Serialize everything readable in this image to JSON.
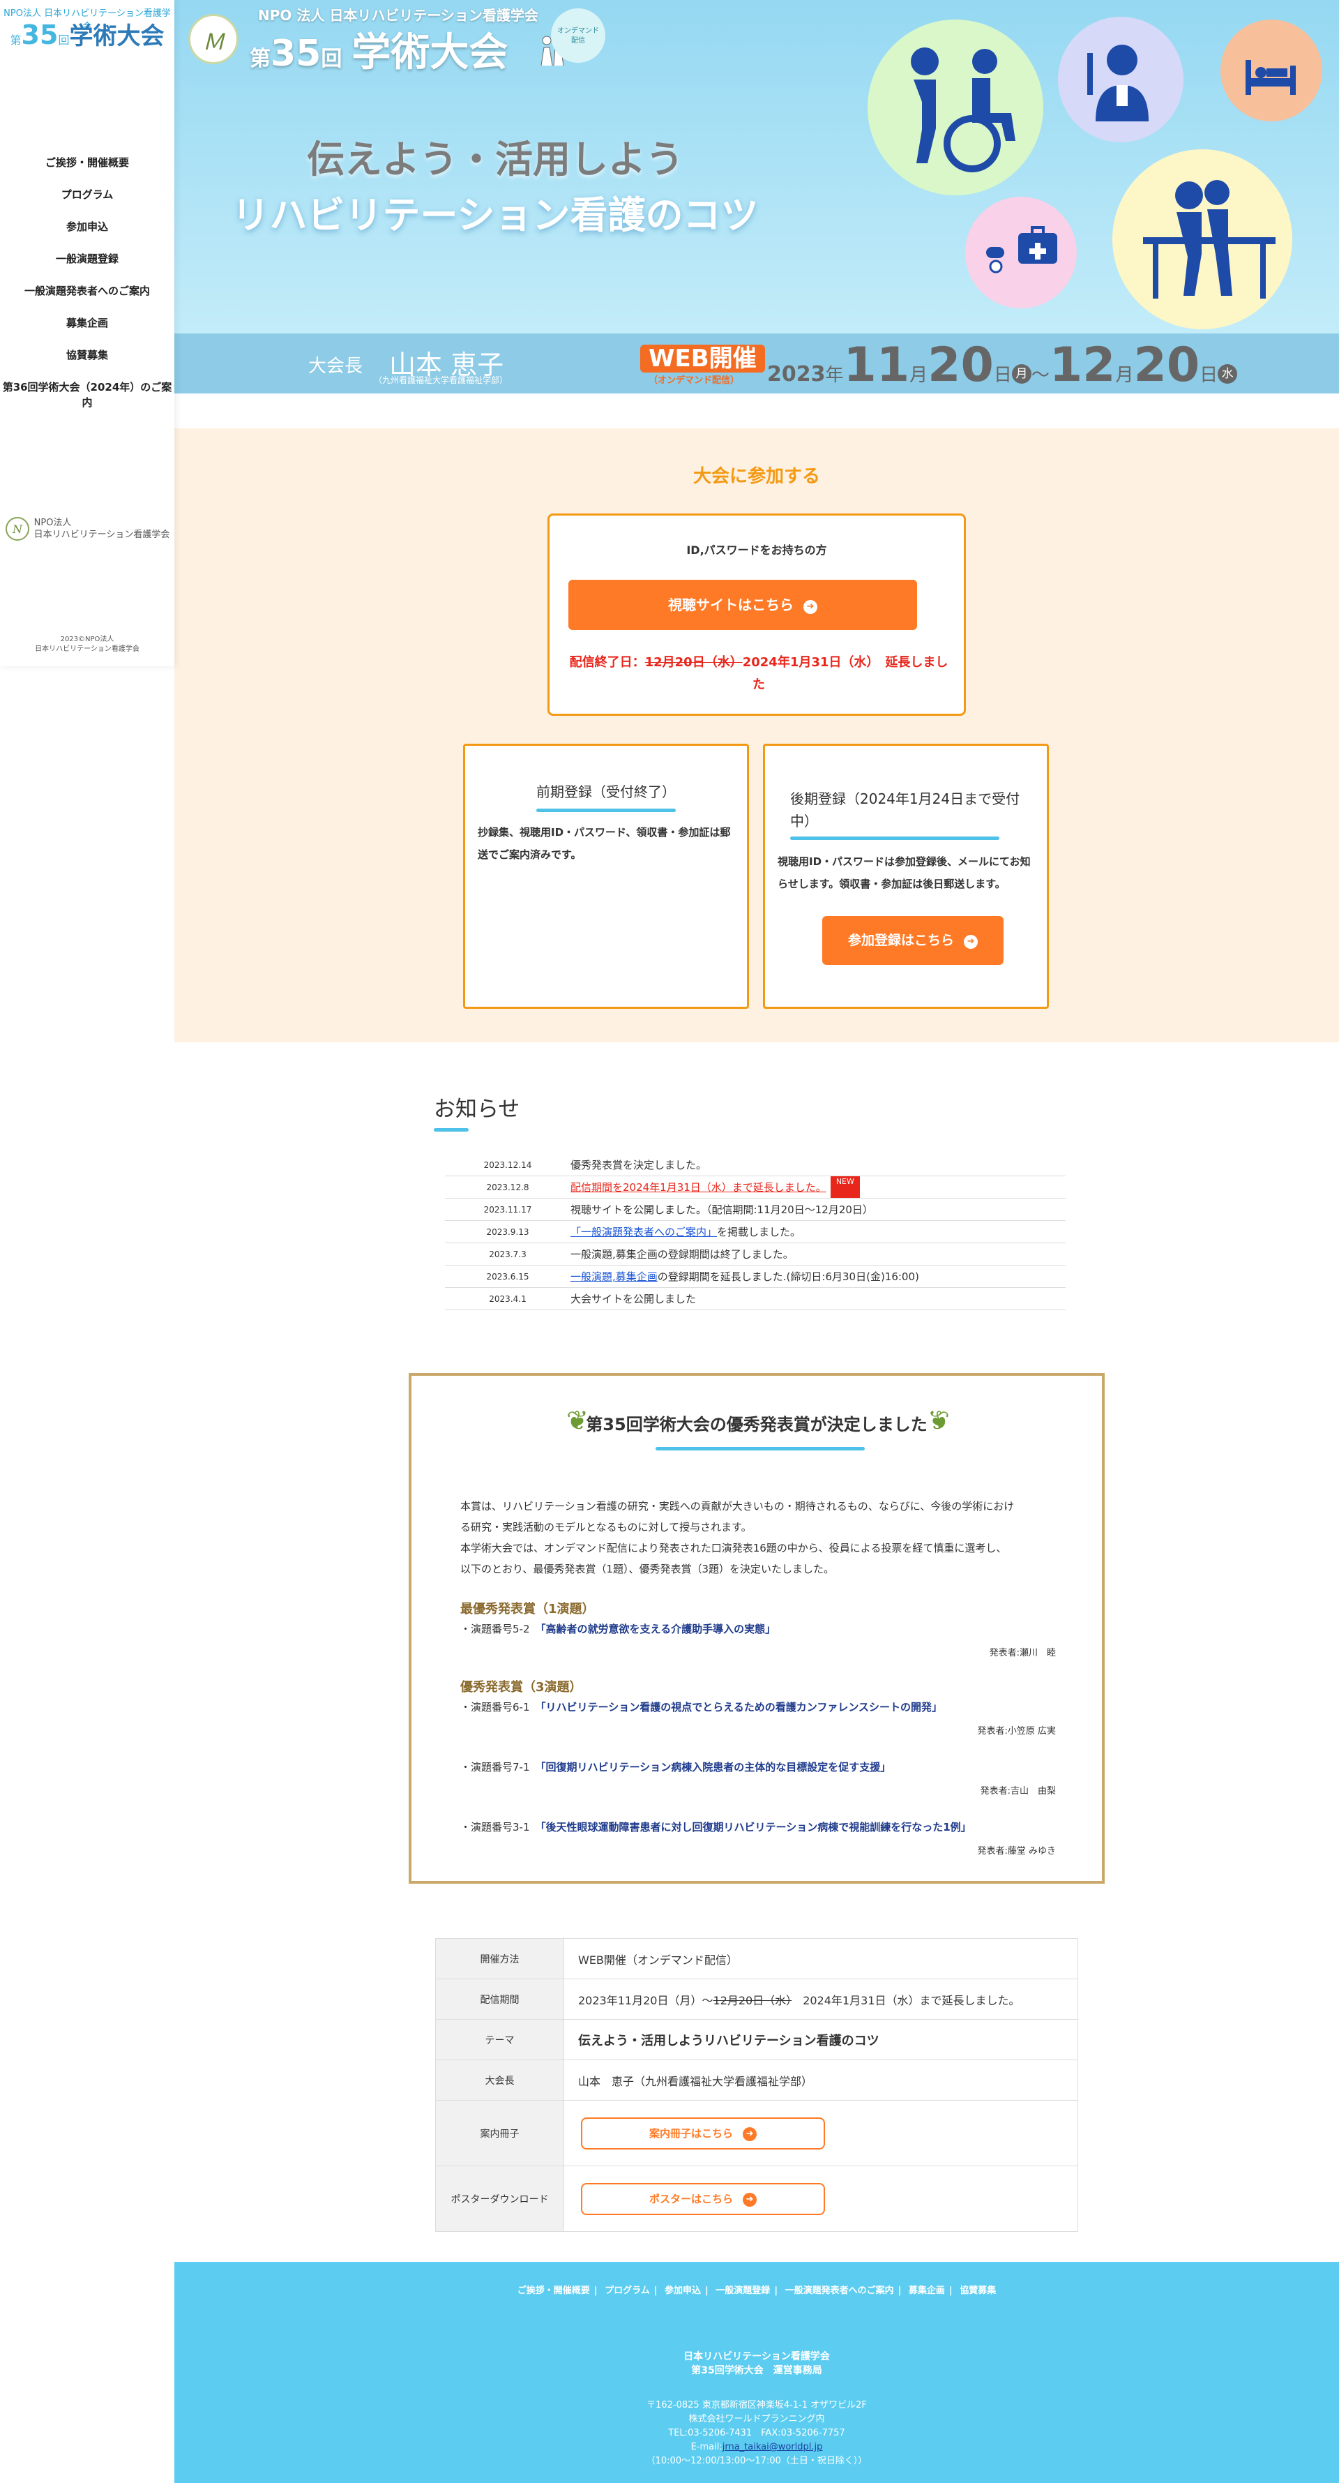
{
  "sidebar": {
    "logo_top": "NPO法人 日本リハビリテーション看護学会",
    "logo_prefix": "第",
    "logo_num": "35",
    "logo_mid": "回",
    "logo_main": "学術大会",
    "nav": [
      "ご挨拶・開催概要",
      "プログラム",
      "参加申込",
      "一般演題登録",
      "一般演題発表者へのご案内",
      "募集企画",
      "協賛募集",
      "第36回学術大会（2024年）のご案内"
    ],
    "org_line1": "NPO法人",
    "org_line2": "日本リハビリテーション看護学会",
    "copy_line1": "2023©NPO法人",
    "copy_line2": "日本リハビリテーション看護学会"
  },
  "hero": {
    "org": "NPO 法人 日本リハビリテーション看護学会",
    "prefix": "第",
    "num": "35",
    "mid": "回",
    "title": "学術大会",
    "ondemand_1": "オンデマンド",
    "ondemand_2": "配信",
    "slogan1": "伝えよう・活用しよう",
    "slogan2": "リハビリテーション看護のコツ"
  },
  "band": {
    "pres_label": "大会長",
    "pres_name": "山本 恵子",
    "pres_aff": "（九州看護福祉大学看護福祉学部）",
    "web": "WEB開催",
    "web_sub": "（オンデマンド配信）",
    "year": "2023",
    "year_unit": "年",
    "m1": "11",
    "m_unit": "月",
    "d1": "20",
    "d_unit": "日",
    "w1": "月",
    "tilde": "〜",
    "m2": "12",
    "d2": "20",
    "w2": "水"
  },
  "participate": {
    "title": "大会に参加する",
    "box1": {
      "label": "ID,パスワードをお持ちの方",
      "button": "視聴サイトはこちら",
      "end_prefix": "配信終了日：",
      "end_strike": "12月20日（水）",
      "end_after": "2024年1月31日（水）　延長しました"
    },
    "box2": {
      "head": "前期登録（受付終了）",
      "text": "抄録集、視聴用ID・パスワード、領収書・参加証は郵送でご案内済みです。"
    },
    "box3": {
      "head": "後期登録（2024年1月24日まで受付中）",
      "text": "視聴用ID・パスワードは参加登録後、メールにてお知らせします。領収書・参加証は後日郵送します。",
      "button": "参加登録はこちら"
    }
  },
  "news": {
    "title": "お知らせ",
    "items": [
      {
        "date": "2023.12.14",
        "pre": "",
        "link": "",
        "text": "優秀発表賞を決定しました。"
      },
      {
        "date": "2023.12.8",
        "pre": "",
        "link": "配信期間を2024年1月31日（水）まで延長しました。",
        "text": "",
        "badge": "NEW"
      },
      {
        "date": "2023.11.17",
        "pre": "",
        "link": "",
        "text": "視聴サイトを公開しました。（配信期間:11月20日〜12月20日）"
      },
      {
        "date": "2023.9.13",
        "pre": "",
        "link": "「一般演題発表者へのご案内」",
        "text": "を掲載しました。"
      },
      {
        "date": "2023.7.3",
        "pre": "",
        "link": "",
        "text": "一般演題,募集企画の登録期間は終了しました。"
      },
      {
        "date": "2023.6.15",
        "pre": "",
        "link": "一般演題,募集企画",
        "text": "の登録期間を延長しました.(締切日:6月30日(金)16:00)"
      },
      {
        "date": "2023.4.1",
        "pre": "",
        "link": "",
        "text": "大会サイトを公開しました"
      }
    ]
  },
  "award": {
    "title": "第35回学術大会の優秀発表賞が決定しました",
    "intro1": "本賞は、リハビリテーション看護の研究・実践への貢献が大きいもの・期待されるもの、ならびに、今後の学術におけ",
    "intro2": "る研究・実践活動のモデルとなるものに対して授与されます。",
    "intro3": "本学術大会では、オンデマンド配信により発表された口演発表16題の中から、役員による投票を経て慎重に選考し、",
    "intro4": "以下のとおり、最優秀発表賞（1題）、優秀発表賞（3題）を決定いたしました。",
    "cat1": "最優秀発表賞（1演題）",
    "cat2": "優秀発表賞（3演題）",
    "items": [
      {
        "no": "・演題番号5-2",
        "title": "「高齢者の就労意欲を支える介護助手導入の実態」",
        "author": "発表者:瀬川　睦"
      },
      {
        "no": "・演題番号6-1",
        "title": "「リハビリテーション看護の視点でとらえるための看護カンファレンスシートの開発」",
        "author": "発表者:小笠原 広実"
      },
      {
        "no": "・演題番号7-1",
        "title": "「回復期リハビリテーション病棟入院患者の主体的な目標設定を促す支援」",
        "author": "発表者:吉山　由梨"
      },
      {
        "no": "・演題番号3-1",
        "title": "「後天性眼球運動障害患者に対し回復期リハビリテーション病棟で視能訓練を行なった1例」",
        "author": "発表者:藤堂 みゆき"
      }
    ]
  },
  "info": {
    "rows": [
      {
        "k": "開催方法",
        "v": "WEB開催（オンデマンド配信）"
      },
      {
        "k": "配信期間",
        "v1": "2023年11月20日（月）〜",
        "strike": "12月20日（水）",
        "v2": "　2024年1月31日（水）まで延長しました。"
      },
      {
        "k": "テーマ",
        "v": "伝えよう・活用しようリハビリテーション看護のコツ"
      },
      {
        "k": "大会長",
        "v": "山本　恵子（九州看護福祉大学看護福祉学部）"
      },
      {
        "k": "案内冊子",
        "btn": "案内冊子はこちら"
      },
      {
        "k": "ポスターダウンロード",
        "btn": "ポスターはこちら"
      }
    ]
  },
  "footer": {
    "nav": [
      "ご挨拶・開催概要",
      "プログラム",
      "参加申込",
      "一般演題登録",
      "一般演題発表者へのご案内",
      "募集企画",
      "協賛募集"
    ],
    "org1": "日本リハビリテーション看護学会",
    "org2": "第35回学術大会　運営事務局",
    "addr1": "〒162-0825 東京都新宿区神楽坂4-1-1 オザワビル2F",
    "addr2": "株式会社ワールドプランニング内",
    "tel": "TEL:03-5206-7431　FAX:03-5206-7757",
    "email_label": "E-mail:",
    "email": "jrna_taikai@worldpl.jp",
    "hours": "（10:00〜12:00/13:00〜17:00（土日・祝日除く））"
  },
  "colors": {
    "accent": "#ff7a26",
    "sky": "#5ccdf0",
    "gold": "#c9a86a",
    "alert": "#e8261b"
  }
}
